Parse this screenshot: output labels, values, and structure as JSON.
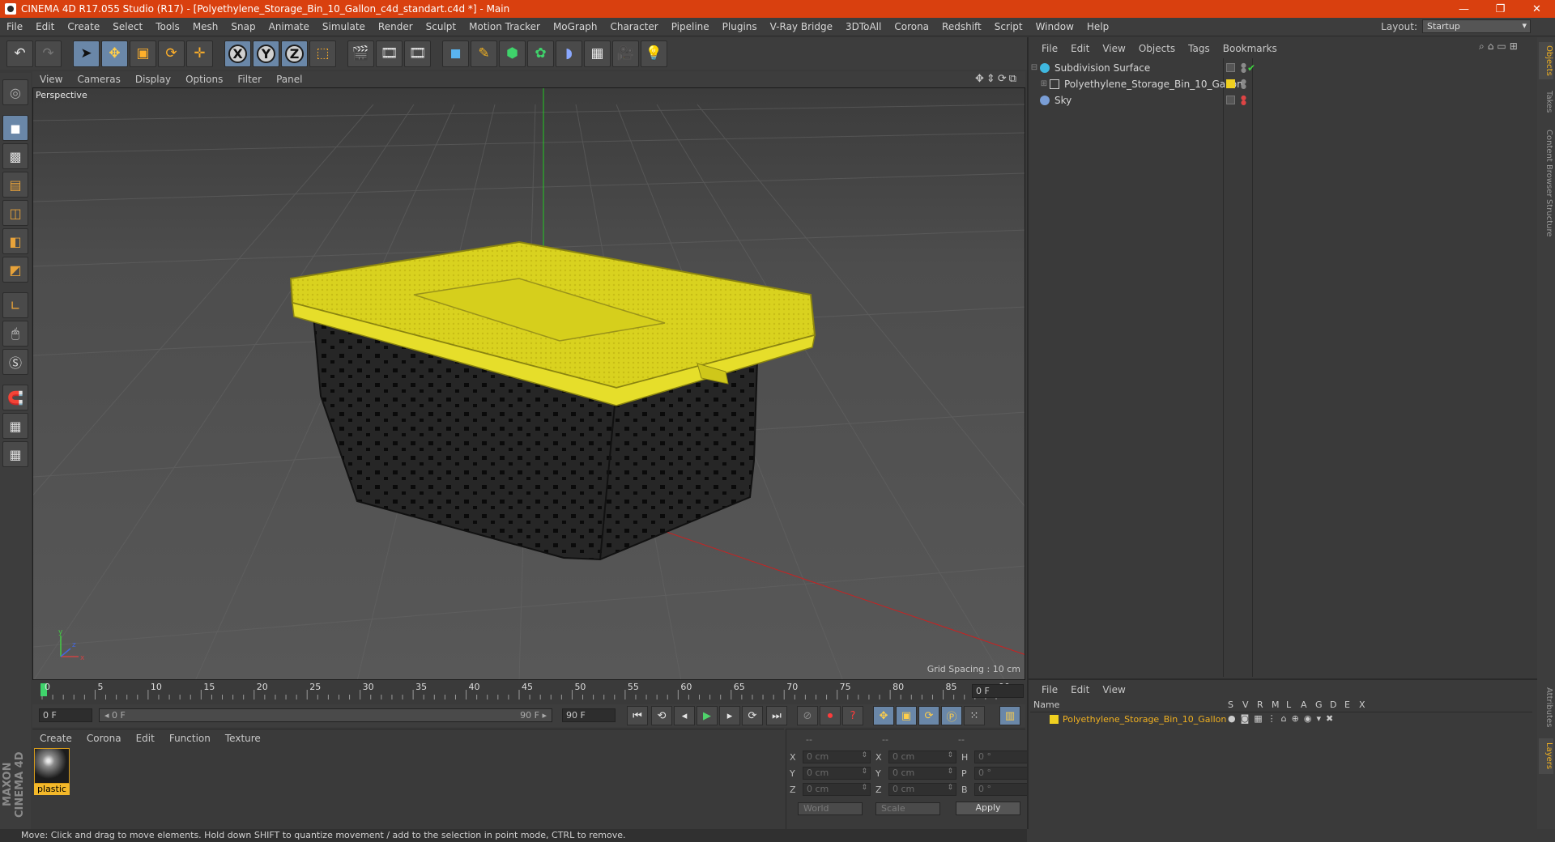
{
  "window": {
    "title": "CINEMA 4D R17.055 Studio (R17) - [Polyethylene_Storage_Bin_10_Gallon_c4d_standart.c4d *] - Main",
    "minimize": "—",
    "maximize": "❐",
    "close": "✕"
  },
  "menubar": {
    "items": [
      "File",
      "Edit",
      "Create",
      "Select",
      "Tools",
      "Mesh",
      "Snap",
      "Animate",
      "Simulate",
      "Render",
      "Sculpt",
      "Motion Tracker",
      "MoGraph",
      "Character",
      "Pipeline",
      "Plugins",
      "V-Ray Bridge",
      "3DToAll",
      "Corona",
      "Redshift",
      "Script",
      "Window",
      "Help"
    ],
    "layout_label": "Layout:",
    "layout_value": "Startup"
  },
  "viewport": {
    "menu": [
      "View",
      "Cameras",
      "Display",
      "Options",
      "Filter",
      "Panel"
    ],
    "camera_label": "Perspective",
    "grid_spacing": "Grid Spacing : 10 cm",
    "axis_x": "x",
    "axis_y": "y",
    "axis_z": "z"
  },
  "timeline": {
    "ticks": [
      "0",
      "5",
      "10",
      "15",
      "20",
      "25",
      "30",
      "35",
      "40",
      "45",
      "50",
      "55",
      "60",
      "65",
      "70",
      "75",
      "80",
      "85",
      "90"
    ],
    "current_frame": "0 F",
    "start_frame": "0 F",
    "range_start": "◂ 0 F",
    "range_end": "90 F ▸",
    "end_frame": "90 F"
  },
  "materials": {
    "menu": [
      "Create",
      "Corona",
      "Edit",
      "Function",
      "Texture"
    ],
    "items": [
      {
        "name": "plastic"
      }
    ]
  },
  "coordinates": {
    "headers": [
      "--",
      "--",
      "--"
    ],
    "rows": [
      {
        "a_label": "X",
        "a_value": "0 cm",
        "b_label": "X",
        "b_value": "0 cm",
        "c_label": "H",
        "c_value": "0 °"
      },
      {
        "a_label": "Y",
        "a_value": "0 cm",
        "b_label": "Y",
        "b_value": "0 cm",
        "c_label": "P",
        "c_value": "0 °"
      },
      {
        "a_label": "Z",
        "a_value": "0 cm",
        "b_label": "Z",
        "b_value": "0 cm",
        "c_label": "B",
        "c_value": "0 °"
      }
    ],
    "space_select": "World",
    "mode_select": "Scale",
    "apply_label": "Apply"
  },
  "objects": {
    "menu": [
      "File",
      "Edit",
      "View",
      "Objects",
      "Tags",
      "Bookmarks"
    ],
    "items": [
      {
        "name": "Subdivision Surface",
        "expander": "⊟",
        "icon_color": "#3fb8e0"
      },
      {
        "name": "Polyethylene_Storage_Bin_10_Gallon",
        "expander": "⊞",
        "icon_color": "#f0d020"
      },
      {
        "name": "Sky",
        "expander": "",
        "icon_color": "#7a9ed6"
      }
    ]
  },
  "layers": {
    "menu": [
      "File",
      "Edit",
      "View"
    ],
    "columns": [
      "Name",
      "S",
      "V",
      "R",
      "M",
      "L",
      "A",
      "G",
      "D",
      "E",
      "X"
    ],
    "rows": [
      {
        "name": "Polyethylene_Storage_Bin_10_Gallon",
        "color": "#f0d020"
      }
    ]
  },
  "side_tabs": [
    "Objects",
    "Takes",
    "Content Browser",
    "Structure",
    "Attributes",
    "Layers"
  ],
  "status": "Move: Click and drag to move elements. Hold down SHIFT to quantize movement / add to the selection in point mode, CTRL to remove.",
  "maxon": "MAXON CINEMA 4D",
  "colors": {
    "title_bar": "#d9400f",
    "accent": "#f0b020",
    "active_tool": "#6a87a8",
    "lid_yellow": "#e6de2a",
    "bin_black": "#1e1e1e"
  }
}
